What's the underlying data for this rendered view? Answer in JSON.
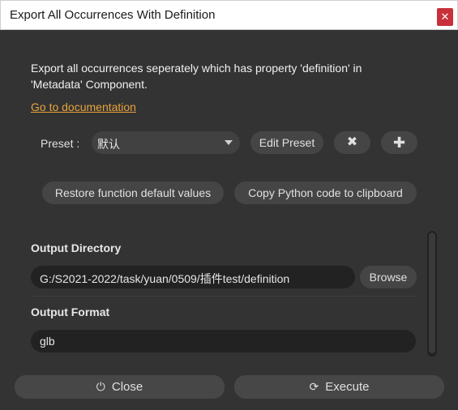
{
  "window": {
    "title": "Export All Occurrences With Definition",
    "close_glyph": "✕"
  },
  "description": "Export all occurrences seperately which has property 'definition' in 'Metadata' Component.",
  "doc_link": "Go to documentation",
  "preset": {
    "label": "Preset :",
    "selected": "默认",
    "edit_label": "Edit Preset",
    "delete_glyph": "✖",
    "add_glyph": "✚"
  },
  "actions": {
    "restore_label": "Restore function default values",
    "copy_label": "Copy Python code to clipboard"
  },
  "output_directory": {
    "title": "Output Directory",
    "value": "G:/S2021-2022/task/yuan/0509/插件test/definition",
    "browse_label": "Browse"
  },
  "output_format": {
    "title": "Output Format",
    "value": "glb"
  },
  "footer": {
    "close_label": "Close",
    "close_icon_glyph": "⏻",
    "execute_label": "Execute",
    "execute_icon_glyph": "⟳"
  },
  "colors": {
    "accent_link": "#e8a43c",
    "close_red": "#c9313a"
  }
}
